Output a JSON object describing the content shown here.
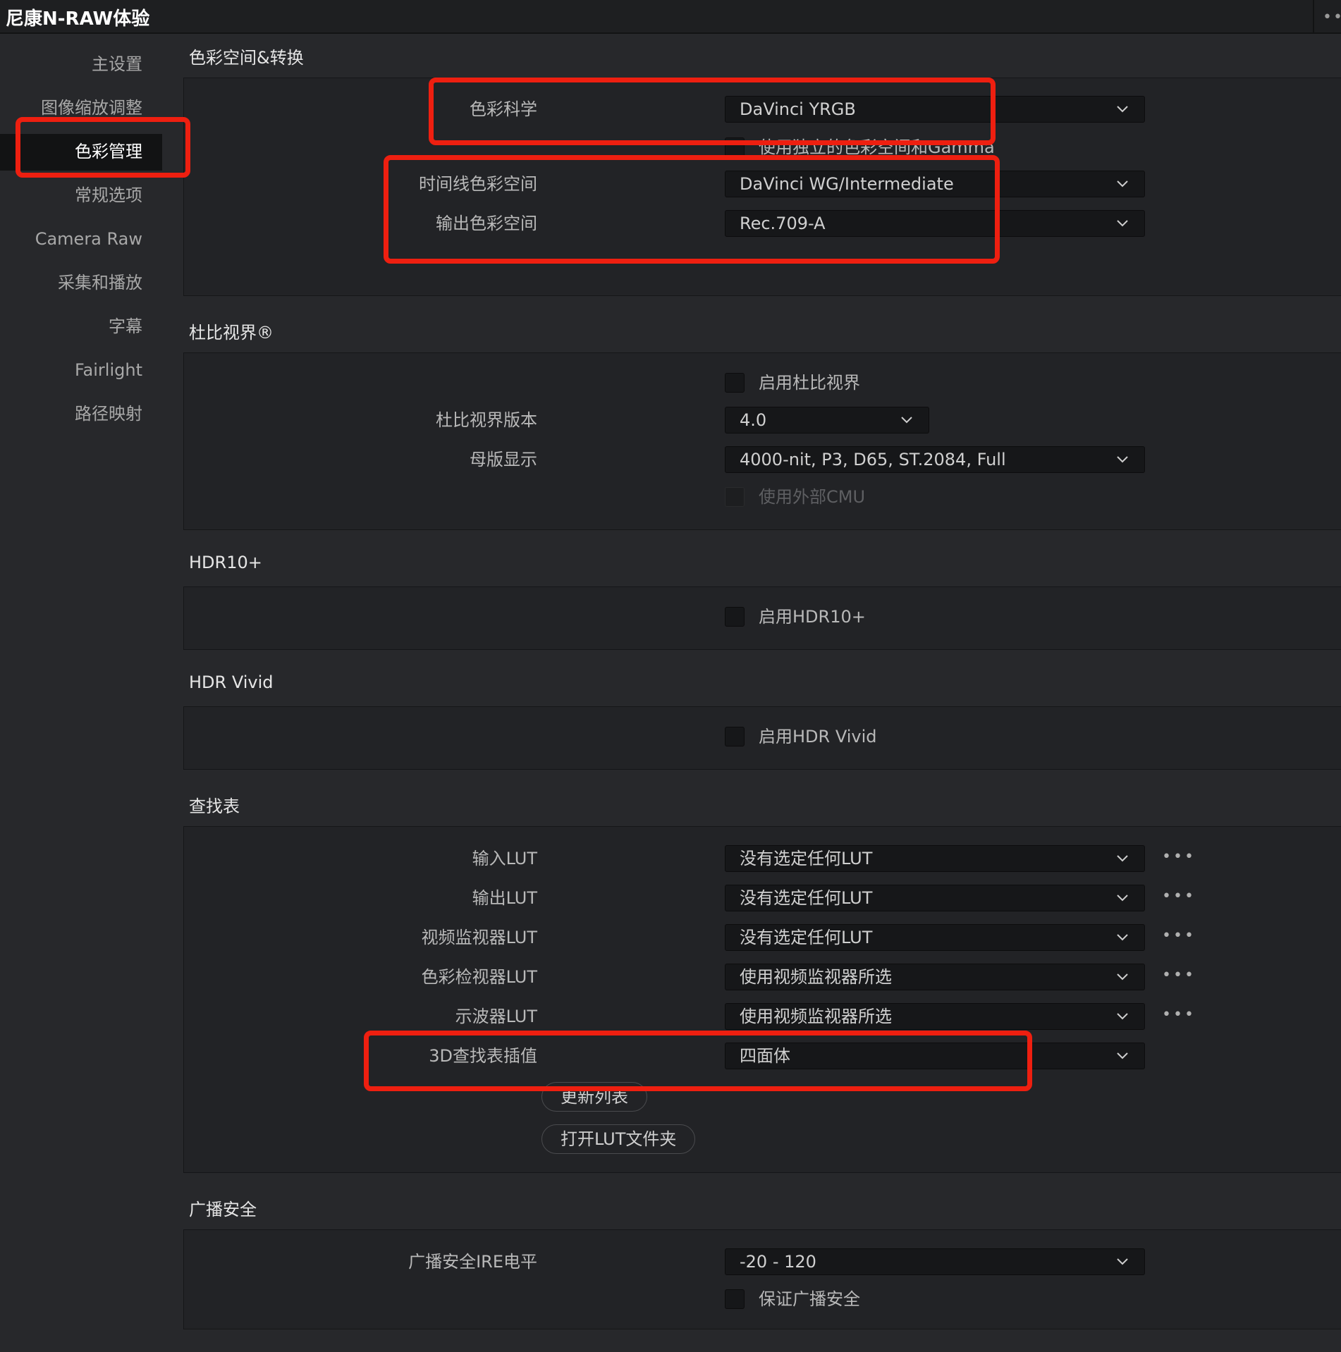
{
  "app_title": "尼康N-RAW体验",
  "top_more_icon": "ellipsis-icon",
  "colors": {
    "highlight": "#ee1f10",
    "background": "#27282b",
    "panel": "#222326",
    "field": "#161719"
  },
  "sidebar": {
    "items": [
      {
        "label": "主设置"
      },
      {
        "label": "图像缩放调整"
      },
      {
        "label": "色彩管理",
        "active": true
      },
      {
        "label": "常规选项"
      },
      {
        "label": "Camera Raw"
      },
      {
        "label": "采集和播放"
      },
      {
        "label": "字幕"
      },
      {
        "label": "Fairlight"
      },
      {
        "label": "路径映射"
      }
    ]
  },
  "color_space": {
    "title": "色彩空间&转换",
    "color_science": {
      "label": "色彩科学",
      "value": "DaVinci YRGB"
    },
    "separate_gamma": {
      "label": "使用独立的色彩空间和Gamma",
      "checked": false
    },
    "timeline_space": {
      "label": "时间线色彩空间",
      "value": "DaVinci WG/Intermediate"
    },
    "output_space": {
      "label": "输出色彩空间",
      "value": "Rec.709-A"
    }
  },
  "dolby": {
    "title": "杜比视界®",
    "enable": {
      "label": "启用杜比视界",
      "checked": false
    },
    "version": {
      "label": "杜比视界版本",
      "value": "4.0"
    },
    "mastering": {
      "label": "母版显示",
      "value": "4000-nit, P3, D65, ST.2084, Full"
    },
    "external_cmu": {
      "label": "使用外部CMU",
      "checked": false,
      "disabled": true
    }
  },
  "hdr10": {
    "title": "HDR10+",
    "enable": {
      "label": "启用HDR10+",
      "checked": false
    }
  },
  "hdr_vivid": {
    "title": "HDR Vivid",
    "enable": {
      "label": "启用HDR Vivid",
      "checked": false
    }
  },
  "lut": {
    "title": "查找表",
    "input": {
      "label": "输入LUT",
      "value": "没有选定任何LUT"
    },
    "output": {
      "label": "输出LUT",
      "value": "没有选定任何LUT"
    },
    "video_monitor": {
      "label": "视频监视器LUT",
      "value": "没有选定任何LUT"
    },
    "color_viewer": {
      "label": "色彩检视器LUT",
      "value": "使用视频监视器所选"
    },
    "scope": {
      "label": "示波器LUT",
      "value": "使用视频监视器所选"
    },
    "interp": {
      "label": "3D查找表插值",
      "value": "四面体"
    },
    "update_button": "更新列表",
    "open_folder_button": "打开LUT文件夹",
    "dots": "•••"
  },
  "broadcast": {
    "title": "广播安全",
    "ire": {
      "label": "广播安全IRE电平",
      "value": "-20 - 120"
    },
    "ensure": {
      "label": "保证广播安全",
      "checked": false
    }
  }
}
